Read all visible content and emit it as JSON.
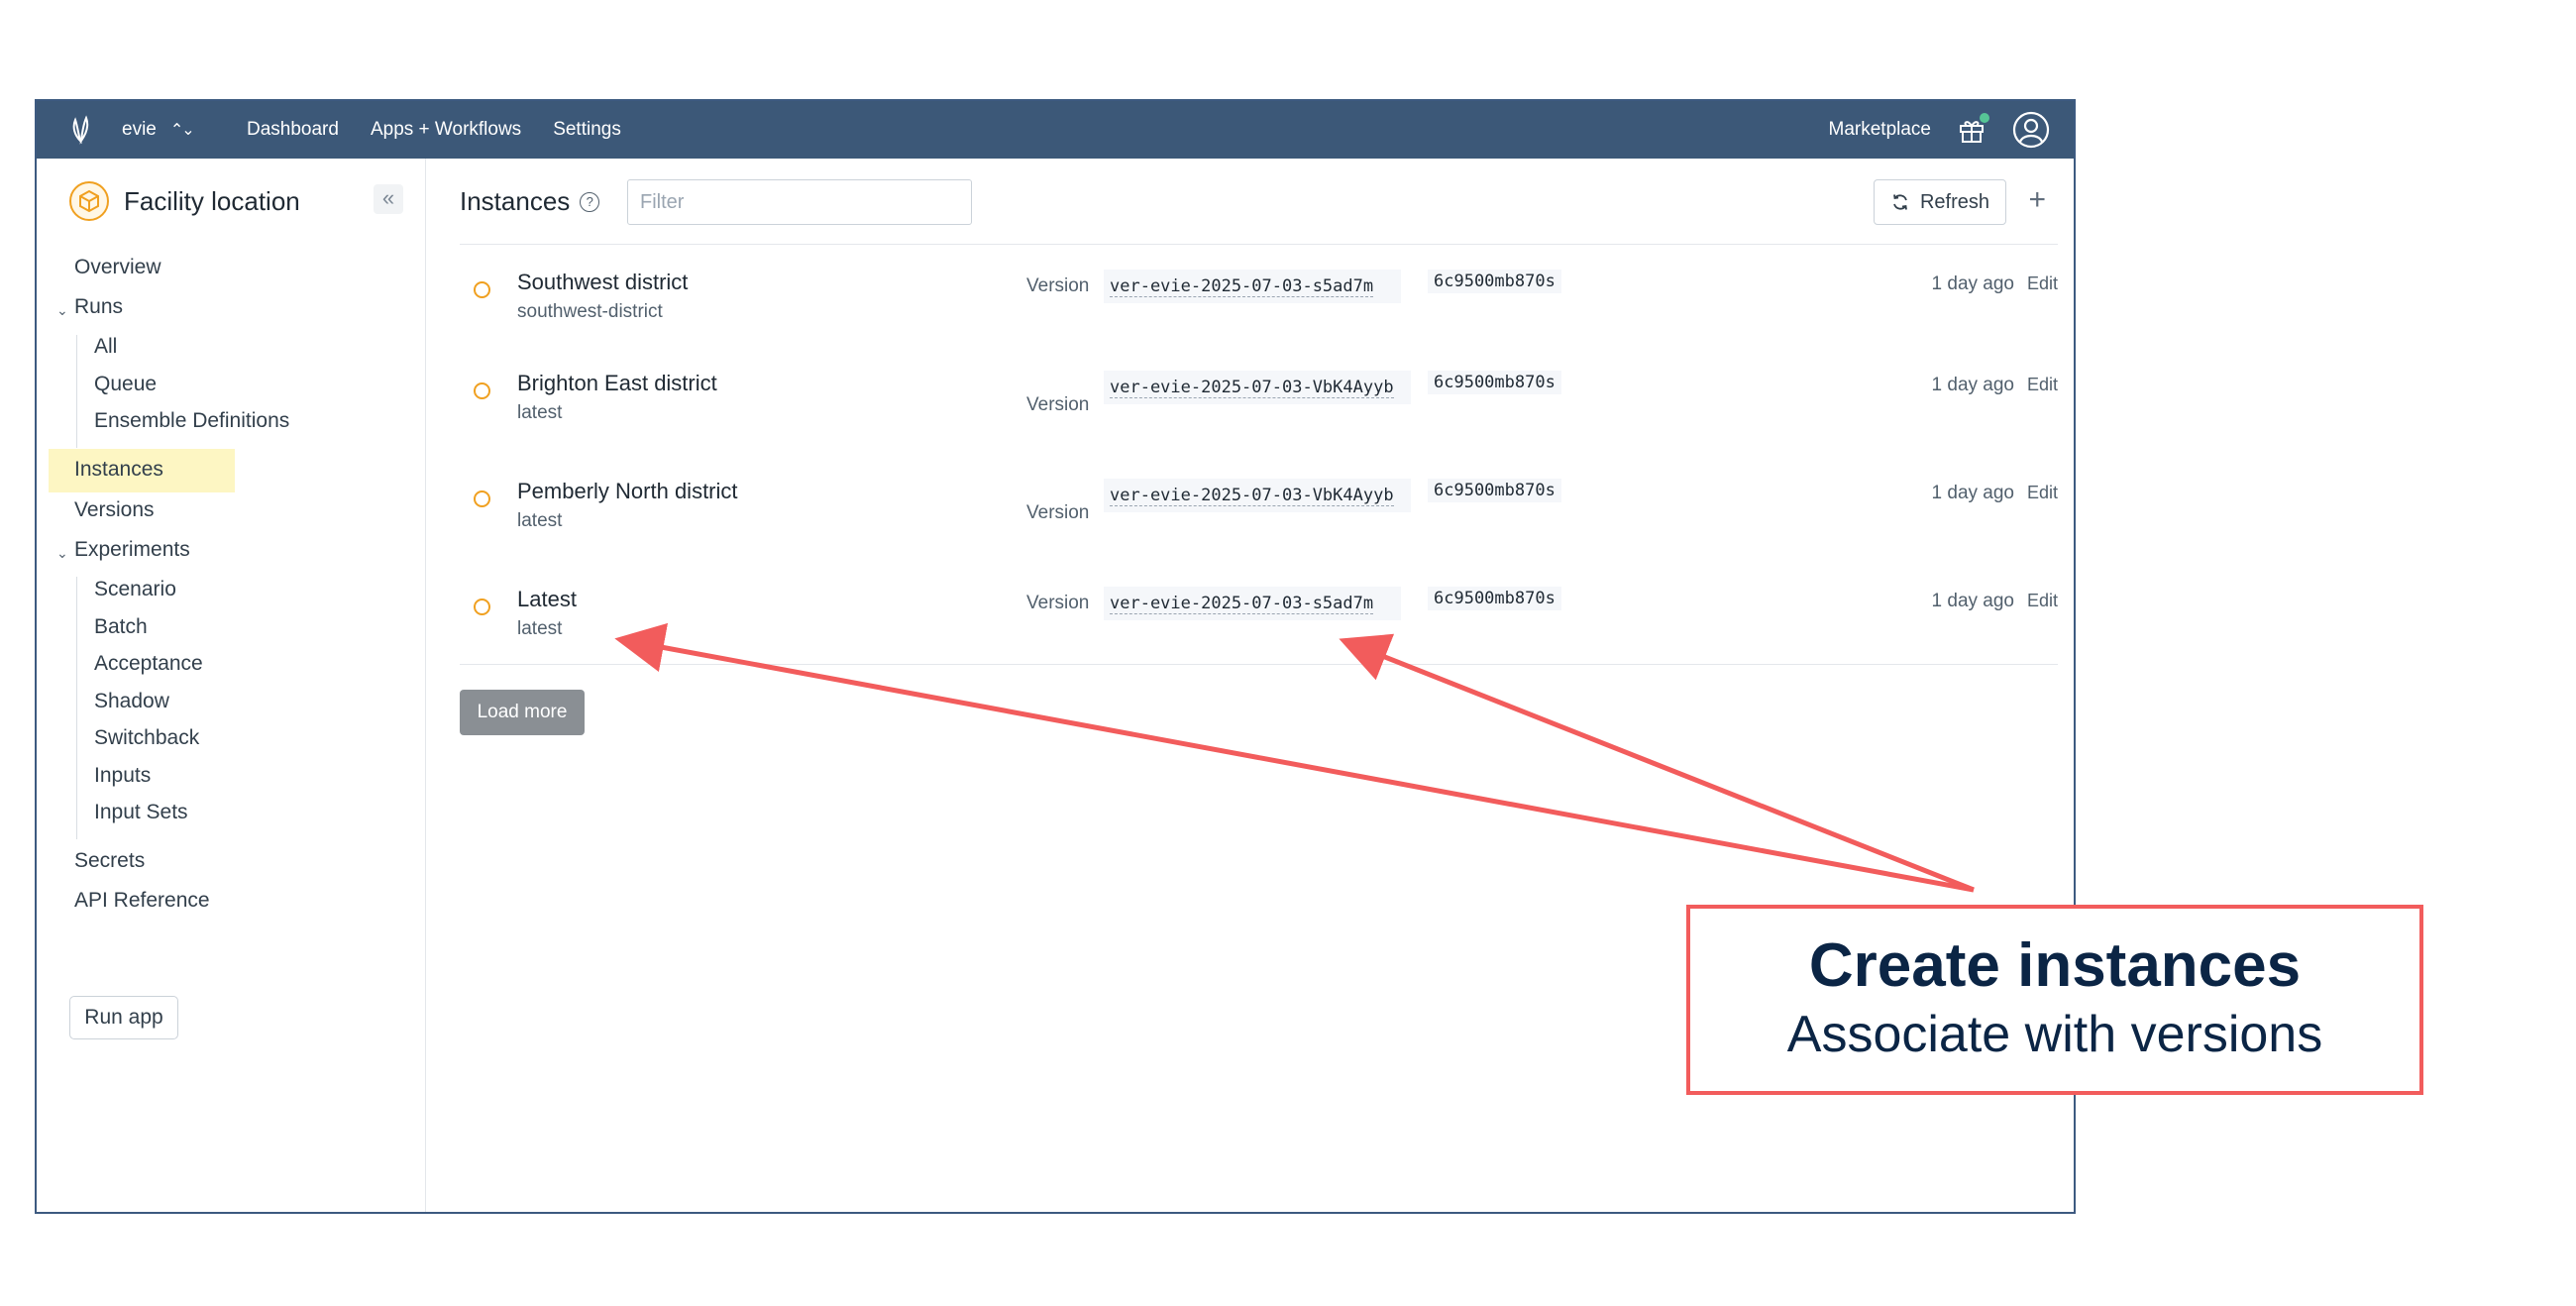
{
  "topbar": {
    "org": "evie",
    "nav": [
      "Dashboard",
      "Apps + Workflows",
      "Settings"
    ],
    "marketplace": "Marketplace"
  },
  "sidebar": {
    "app_name": "Facility location",
    "overview": "Overview",
    "runs": "Runs",
    "runs_items": [
      "All",
      "Queue",
      "Ensemble Definitions"
    ],
    "instances": "Instances",
    "versions": "Versions",
    "experiments": "Experiments",
    "experiments_items": [
      "Scenario",
      "Batch",
      "Acceptance",
      "Shadow",
      "Switchback",
      "Inputs",
      "Input Sets"
    ],
    "secrets": "Secrets",
    "api_reference": "API Reference",
    "run_app": "Run app"
  },
  "main": {
    "title": "Instances",
    "filter_placeholder": "Filter",
    "refresh": "Refresh",
    "add": "+",
    "version_label": "Version",
    "edit_label": "Edit",
    "load_more": "Load more",
    "rows": [
      {
        "name": "Southwest district",
        "slug": "southwest-district",
        "version": "ver-evie-2025-07-03-s5ad7m",
        "commit": "6c9500mb870s",
        "time": "1 day ago"
      },
      {
        "name": "Brighton East district",
        "slug": "latest",
        "version": "ver-evie-2025-07-03-VbK4Ayyb",
        "commit": "6c9500mb870s",
        "time": "1 day ago"
      },
      {
        "name": "Pemberly North district",
        "slug": "latest",
        "version": "ver-evie-2025-07-03-VbK4Ayyb",
        "commit": "6c9500mb870s",
        "time": "1 day ago"
      },
      {
        "name": "Latest",
        "slug": "latest",
        "version": "ver-evie-2025-07-03-s5ad7m",
        "commit": "6c9500mb870s",
        "time": "1 day ago"
      }
    ]
  },
  "callout": {
    "title": "Create instances",
    "subtitle": "Associate with versions",
    "color": "#f25c5c"
  }
}
